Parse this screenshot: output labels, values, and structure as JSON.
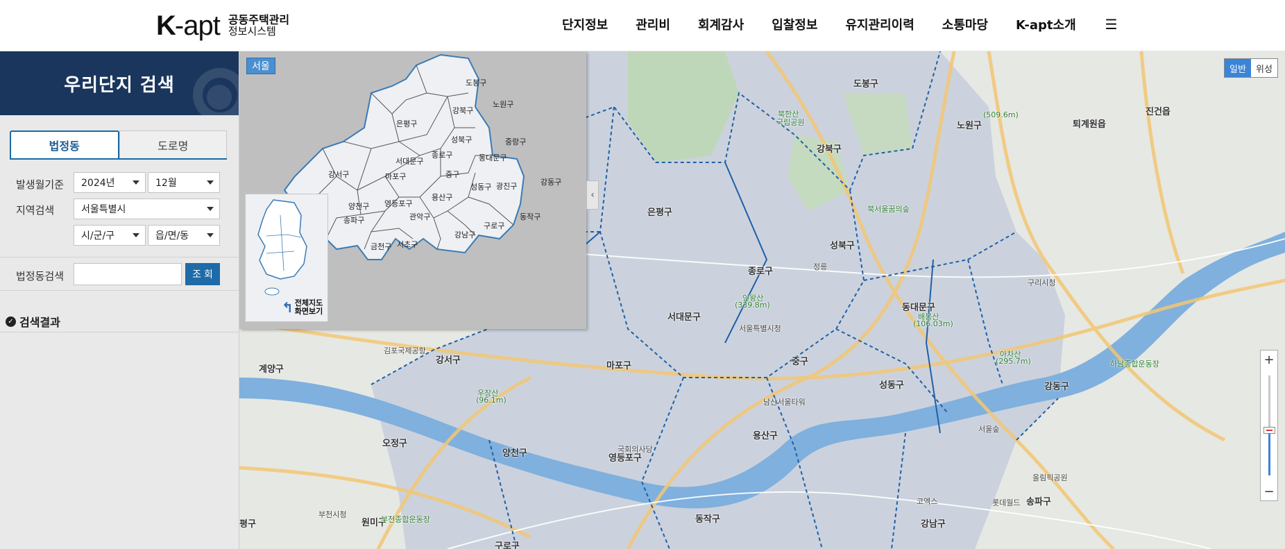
{
  "header": {
    "logo_k": "K",
    "logo_apt": "-apt",
    "logo_line1": "공동주택관리",
    "logo_line2": "정보시스템",
    "nav": [
      "단지정보",
      "관리비",
      "회계감사",
      "입찰정보",
      "유지관리이력",
      "소통마당",
      "K-apt소개"
    ],
    "menu_icon": "hamburger-icon",
    "menu_glyph": "☰"
  },
  "sidebar": {
    "title": "우리단지 검색",
    "tabs": [
      {
        "label": "법정동",
        "active": true
      },
      {
        "label": "도로명",
        "active": false
      }
    ],
    "period_label": "발생월기준",
    "year_value": "2024년",
    "month_value": "12월",
    "region_label": "지역검색",
    "sido_value": "서울특별시",
    "sigungu_value": "시/군/구",
    "eupmyeondong_value": "읍/면/동",
    "beopdong_label": "법정동검색",
    "beopdong_input": "",
    "search_button": "조 회",
    "result_label": "검색결과"
  },
  "overlay": {
    "city_badge": "서울",
    "districts": [
      "도봉구",
      "노원구",
      "강북구",
      "은평구",
      "성북구",
      "중랑구",
      "종로구",
      "동대문구",
      "서대문구",
      "강서구",
      "마포구",
      "중구",
      "광진구",
      "강동구",
      "용산구",
      "성동구",
      "양천구",
      "영등포구",
      "동작구",
      "송파구",
      "구로구",
      "강남구",
      "서초구",
      "금천구",
      "관악구"
    ],
    "whole_map_button": "전체지도 화면보기"
  },
  "map": {
    "type_general": "일반",
    "type_satellite": "위성",
    "zoom_in": "+",
    "zoom_out": "−",
    "labels": {
      "dobong": "도봉구",
      "nowon": "노원구",
      "gangbuk": "강북구",
      "eunpyeong": "은평구",
      "seongbuk": "성북구",
      "jongno": "종로구",
      "seodaemun": "서대문구",
      "dongdaemun": "동대문구",
      "jung": "중구",
      "mapo": "마포구",
      "gangseo": "강서구",
      "yangcheon": "양천구",
      "yeongdeungpo": "영등포구",
      "yongsan": "용산구",
      "seongdong": "성동구",
      "gangdong": "강동구",
      "songpa": "송파구",
      "gangnam": "강남구",
      "dongjak": "동작구",
      "guro": "구로구",
      "gyeyang": "계양구",
      "ojeong": "오정구",
      "bupyeong": "평구",
      "bucheon_mimi": "원미구",
      "jingeon": "진건읍",
      "toegyewon": "퇴계원읍",
      "bukhansan": "북한산",
      "bukhansan_park": "국립공원",
      "namsan_tower": "남산서울타워",
      "gimpo_airport": "김포국제공항",
      "olympic_park": "올림픽공원",
      "lotte_world": "롯데월드",
      "coex": "코엑스",
      "national_assembly": "국회의사당",
      "seoul_station": "서울특별시청",
      "inwangsan": "인왕산",
      "inwangsan_h": "(339.8m)",
      "baebongsan": "배봉산",
      "baebongsan_h": "(106.03m)",
      "achasan": "아차산",
      "achasan_h": "(295.7m)",
      "usan": "우장산",
      "usan_h": "(96.1m)",
      "buramsan_h": "(509.6m)",
      "bukseoul_forest": "북서울꿈의숲",
      "jeongreung": "정릉",
      "guri_city": "구리시청",
      "hanam_stadium": "하남종합운동장",
      "bucheon_stadium": "부천종합운동장",
      "bucheon_city": "부천시청",
      "seoul_forest": "서울숲"
    }
  }
}
